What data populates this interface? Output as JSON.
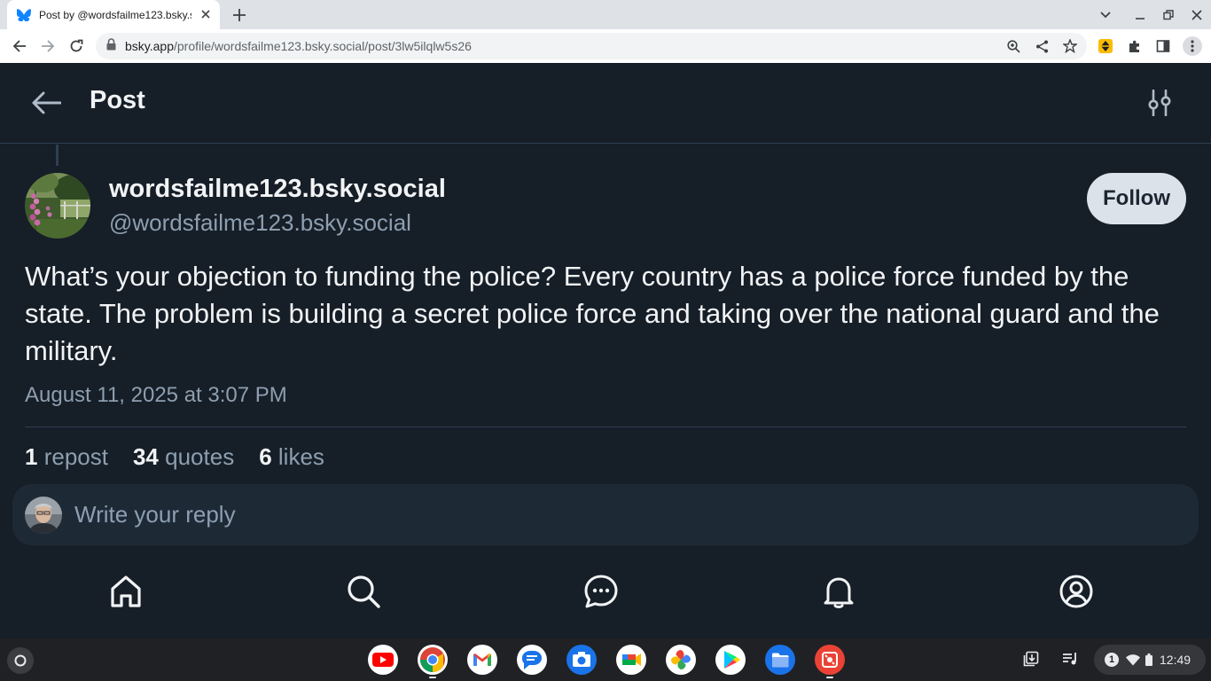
{
  "browser": {
    "tab_title": "Post by @wordsfailme123.bsky.social",
    "url_host": "bsky.app",
    "url_path": "/profile/wordsfailme123.bsky.social/post/3lw5ilqlw5s26"
  },
  "header": {
    "title": "Post"
  },
  "post": {
    "display_name": "wordsfailme123.bsky.social",
    "handle": "@wordsfailme123.bsky.social",
    "follow_label": "Follow",
    "text": "What’s your objection to funding the police? Every country has a police force funded by the state. The problem is building a secret police force and taking over the national guard and the military.",
    "timestamp": "August 11, 2025 at 3:07 PM"
  },
  "stats": {
    "reposts_count": "1",
    "reposts_label": "repost",
    "quotes_count": "34",
    "quotes_label": "quotes",
    "likes_count": "6",
    "likes_label": "likes"
  },
  "reply": {
    "placeholder": "Write your reply"
  },
  "bottom_nav": [
    "home-icon",
    "search-icon",
    "chat-icon",
    "bell-icon",
    "profile-icon"
  ],
  "shelf": {
    "apps": [
      "youtube",
      "chrome",
      "gmail",
      "messages",
      "camera",
      "meet",
      "photos",
      "play-store",
      "files",
      "screencast"
    ],
    "notification_count": "1",
    "time": "12:49"
  },
  "colors": {
    "background": "#161e27",
    "text_primary": "#f1f3f5",
    "text_secondary": "#8d9fb0",
    "follow_button": "#dce2ea",
    "reply_box": "#1e2936",
    "bluesky_blue": "#1185fe"
  }
}
